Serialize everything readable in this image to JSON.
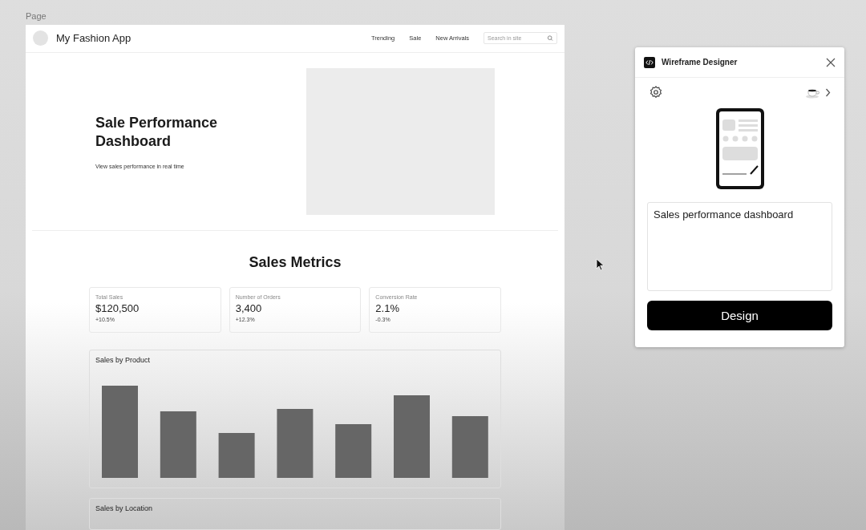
{
  "canvas": {
    "label": "Page"
  },
  "app": {
    "title": "My Fashion App",
    "nav": [
      "Trending",
      "Sale",
      "New Arrivals"
    ],
    "search": {
      "placeholder": "Search in site"
    },
    "hero": {
      "title": "Sale Performance Dashboard",
      "subtitle": "View sales performance in real time"
    },
    "metrics_title": "Sales Metrics",
    "metrics": [
      {
        "label": "Total Sales",
        "value": "$120,500",
        "change": "+10.5%"
      },
      {
        "label": "Number of Orders",
        "value": "3,400",
        "change": "+12.3%"
      },
      {
        "label": "Conversion Rate",
        "value": "2.1%",
        "change": "-0.3%"
      }
    ],
    "charts": [
      {
        "title": "Sales by Product",
        "kind": "bars"
      },
      {
        "title": "Sales by Location",
        "kind": "empty"
      }
    ]
  },
  "plugin": {
    "title": "Wireframe Designer",
    "prompt": "Sales performance dashboard",
    "button": "Design"
  }
}
